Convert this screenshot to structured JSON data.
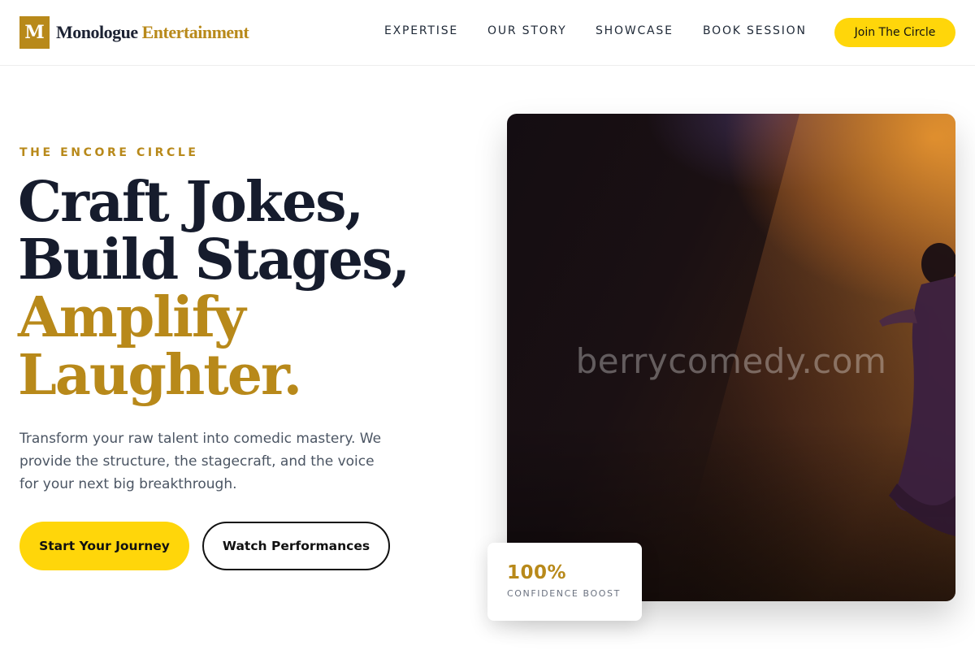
{
  "brand": {
    "mark": "M",
    "name_primary": "Monologue",
    "name_accent": "Entertainment"
  },
  "nav": {
    "items": [
      {
        "label": "EXPERTISE"
      },
      {
        "label": "OUR STORY"
      },
      {
        "label": "SHOWCASE"
      },
      {
        "label": "BOOK SESSION"
      }
    ],
    "cta_label": "Join The Circle"
  },
  "hero": {
    "eyebrow": "THE ENCORE CIRCLE",
    "headline_line1": "Craft Jokes,",
    "headline_line2": "Build Stages,",
    "headline_line3": "Amplify",
    "headline_line4": "Laughter.",
    "description": "Transform your raw talent into comedic mastery. We provide the structure, the stagecraft, and the voice for your next big breakthrough.",
    "primary_button": "Start Your Journey",
    "secondary_button": "Watch Performances",
    "image_watermark": "berrycomedy.com",
    "stat_value": "100%",
    "stat_label": "CONFIDENCE BOOST"
  },
  "colors": {
    "accent_gold": "#b8891a",
    "button_yellow": "#ffd60a",
    "heading_dark": "#161c2d"
  }
}
